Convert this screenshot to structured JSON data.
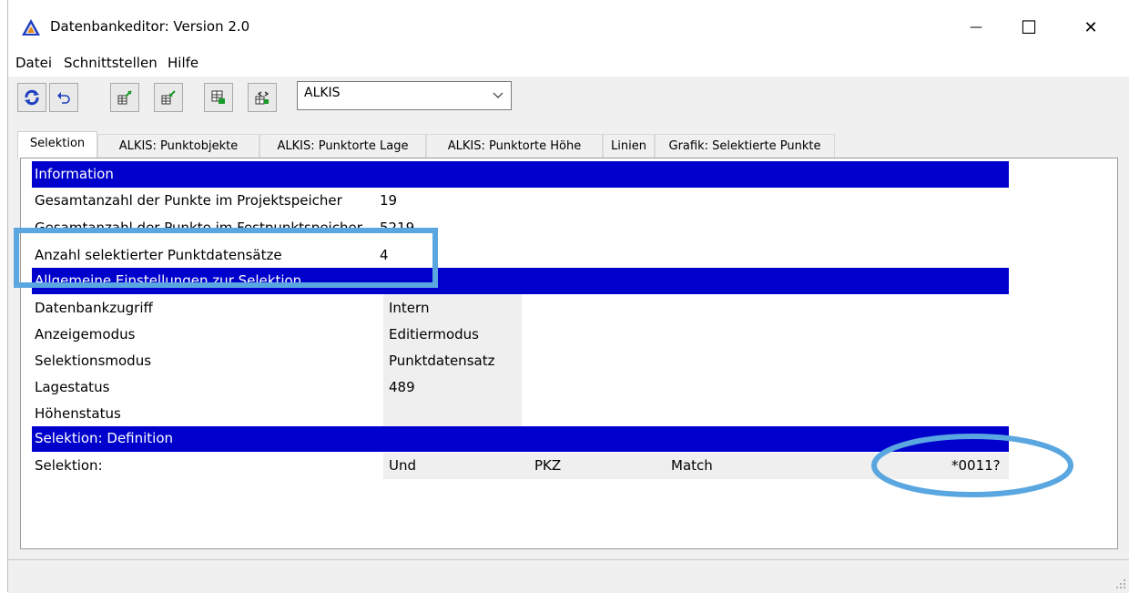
{
  "window": {
    "title": "Datenbankeditor: Version 2.0",
    "controls": {
      "minimize": "—",
      "maximize": "☐",
      "close": "✕"
    }
  },
  "menu": {
    "items": [
      "Datei",
      "Schnittstellen",
      "Hilfe"
    ]
  },
  "toolbar": {
    "buttons": [
      "refresh-icon",
      "undo-icon",
      "export-icon",
      "import-icon",
      "database-icon",
      "exchange-icon"
    ],
    "dropdown_value": "ALKIS"
  },
  "tabs": [
    "Selektion",
    "ALKIS: Punktobjekte",
    "ALKIS: Punktorte Lage",
    "ALKIS: Punktorte Höhe",
    "Linien",
    "Grafik: Selektierte Punkte"
  ],
  "active_tab": "Selektion",
  "sections": {
    "information": {
      "header": "Information",
      "rows": [
        {
          "label": "Gesamtanzahl der Punkte im Projektspeicher",
          "value": "19"
        },
        {
          "label": "Gesamtanzahl der Punkte im Festpunktspeicher",
          "value": "5219"
        },
        {
          "label": "Anzahl selektierter Punktdatensätze",
          "value": "4"
        }
      ]
    },
    "settings": {
      "header": "Allgemeine Einstellungen zur Selektion",
      "rows": [
        {
          "label": "Datenbankzugriff",
          "value": "Intern"
        },
        {
          "label": "Anzeigemodus",
          "value": "Editiermodus"
        },
        {
          "label": "Selektionsmodus",
          "value": "Punktdatensatz"
        },
        {
          "label": "Lagestatus",
          "value": "489"
        },
        {
          "label": "Höhenstatus",
          "value": ""
        }
      ]
    },
    "definition": {
      "header": "Selektion: Definition",
      "row": {
        "label": "Selektion:",
        "operator": "Und",
        "field": "PKZ",
        "mode": "Match",
        "pattern": "*0011?"
      }
    }
  },
  "colors": {
    "section_header": "#0000cc",
    "annotation": "#5aa6e0",
    "value_bg": "#efefef"
  }
}
